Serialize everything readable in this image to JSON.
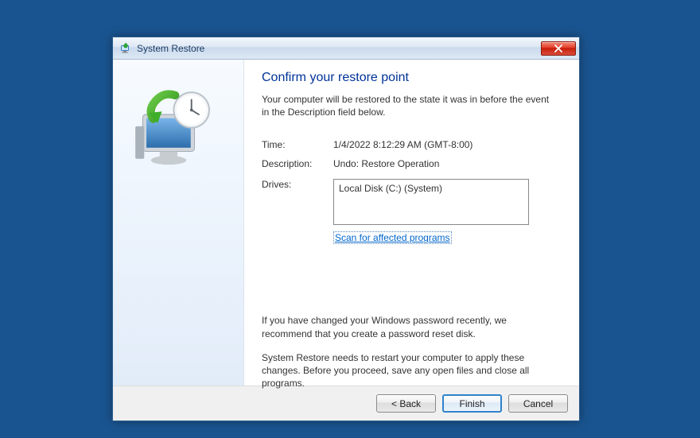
{
  "window": {
    "title": "System Restore"
  },
  "heading": "Confirm your restore point",
  "intro": "Your computer will be restored to the state it was in before the event in the Description field below.",
  "fields": {
    "time_label": "Time:",
    "time_value": "1/4/2022 8:12:29 AM (GMT-8:00)",
    "desc_label": "Description:",
    "desc_value": "Undo: Restore Operation",
    "drives_label": "Drives:",
    "drives_value": "Local Disk (C:) (System)"
  },
  "scan_link": "Scan for affected programs",
  "note_password": "If you have changed your Windows password recently, we recommend that you create a password reset disk.",
  "note_restart": "System Restore needs to restart your computer to apply these changes. Before you proceed, save any open files and close all programs.",
  "buttons": {
    "back": "< Back",
    "finish": "Finish",
    "cancel": "Cancel"
  }
}
